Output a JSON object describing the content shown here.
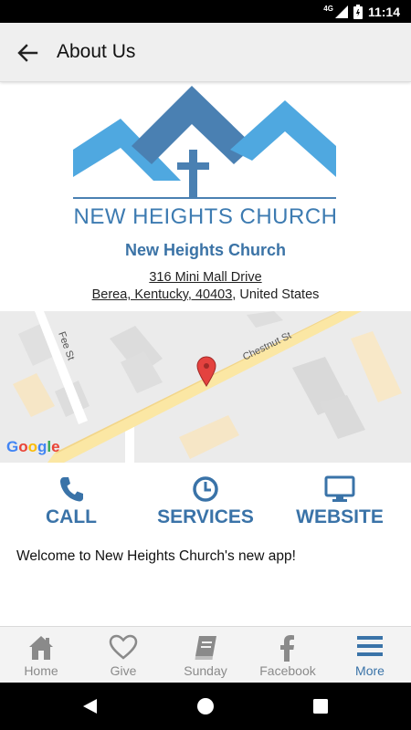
{
  "status_bar": {
    "network": "4G",
    "time": "11:14"
  },
  "app_bar": {
    "title": "About Us"
  },
  "logo": {
    "text": "NEW HEIGHTS CHURCH"
  },
  "church": {
    "name": "New Heights Church",
    "address_line1": "316 Mini Mall Drive",
    "address_line2_link": "Berea, Kentucky, 40403",
    "address_line2_rest": ", United States"
  },
  "map": {
    "street_labels": [
      "Chestnut St",
      "Fee St"
    ],
    "attribution": "Google"
  },
  "actions": [
    {
      "label": "CALL",
      "icon": "phone-icon"
    },
    {
      "label": "SERVICES",
      "icon": "clock-icon"
    },
    {
      "label": "WEBSITE",
      "icon": "monitor-icon"
    }
  ],
  "welcome_text": "Welcome to New Heights Church's new app!",
  "bottom_nav": [
    {
      "label": "Home",
      "icon": "home-icon"
    },
    {
      "label": "Give",
      "icon": "heart-icon"
    },
    {
      "label": "Sunday",
      "icon": "book-icon"
    },
    {
      "label": "Facebook",
      "icon": "facebook-icon"
    },
    {
      "label": "More",
      "icon": "menu-icon",
      "active": true
    }
  ],
  "colors": {
    "accent": "#3a73a8",
    "logo_light": "#4fa8e0",
    "logo_dark": "#4a80b2",
    "inactive": "#8a8a8a"
  }
}
